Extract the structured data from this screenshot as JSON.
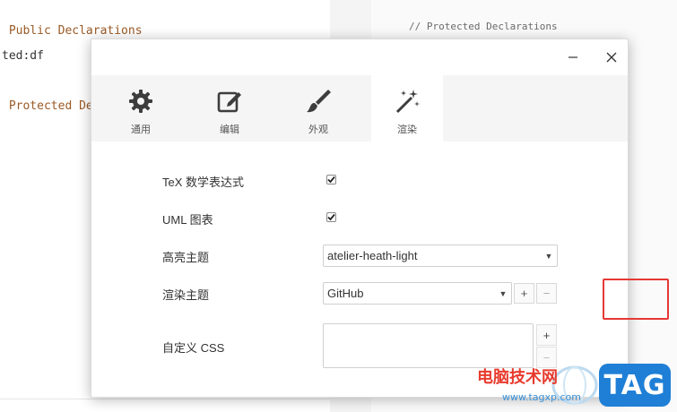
{
  "background": {
    "left_lines": [
      " Public Declarations",
      "ted:df",
      " Protected Dec"
    ],
    "right_lines": [
      "// Protected Declarations"
    ]
  },
  "dialog": {
    "tabs": [
      {
        "label": "通用",
        "icon": "gear-icon"
      },
      {
        "label": "编辑",
        "icon": "edit-icon"
      },
      {
        "label": "外观",
        "icon": "brush-icon"
      },
      {
        "label": "渲染",
        "icon": "magic-wand-icon"
      }
    ],
    "active_tab": "渲染",
    "rows": {
      "tex_label": "TeX 数学表达式",
      "tex_checked": true,
      "uml_label": "UML 图表",
      "uml_checked": true,
      "highlight_label": "高亮主题",
      "highlight_value": "atelier-heath-light",
      "render_label": "渲染主题",
      "render_value": "GitHub",
      "css_label": "自定义 CSS",
      "css_value": ""
    },
    "buttons": {
      "plus": "+",
      "minus": "−"
    }
  },
  "watermark": {
    "site_name": "电脑技术网",
    "url": "www.tagxp.com",
    "tag": "TAG"
  },
  "colors": {
    "highlight_box": "#e53935",
    "tag_bg": "#1f7fd6",
    "watermark_red": "#e83b2e"
  }
}
